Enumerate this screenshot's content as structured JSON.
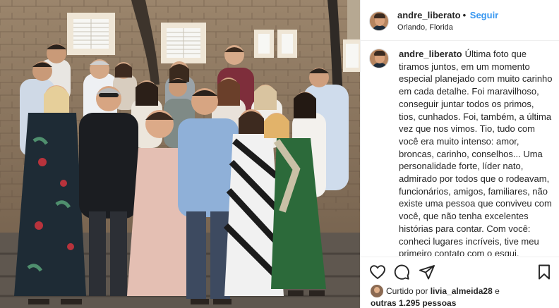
{
  "photo": {
    "description_icon": "group-photo",
    "wall_color": "#8a7560",
    "floor_color": "#6d6358"
  },
  "header": {
    "username": "andre_liberato",
    "separator": "•",
    "follow_label": "Seguir",
    "location": "Orlando, Florida"
  },
  "caption": {
    "username": "andre_liberato",
    "text": "Última foto que tiramos juntos, em um momento especial planejado com muito carinho em cada detalhe. Foi maravilhoso, conseguir juntar todos os primos, tios, cunhados. Foi, também, a última vez que nos vimos. Tio, tudo com você era muito intenso: amor, broncas, carinho, conselhos... Uma personalidade forte, líder nato, admirado por todos que o rodeavam, funcionários, amigos, familiares, não existe uma pessoa que conviveu com você, que não tenha excelentes histórias para contar. Com você: conheci lugares incríveis, tive meu primeiro contato com o esqui, experiências diversas. Como você vai fazer falta.... tive a oportunidade de"
  },
  "actions": {
    "like_icon": "heart-icon",
    "comment_icon": "comment-icon",
    "share_icon": "share-icon",
    "save_icon": "bookmark-icon"
  },
  "likes": {
    "prefix": "Curtido por ",
    "liker": "livia_almeida28",
    "middle": " e",
    "others": "outras 1.295 pessoas"
  }
}
